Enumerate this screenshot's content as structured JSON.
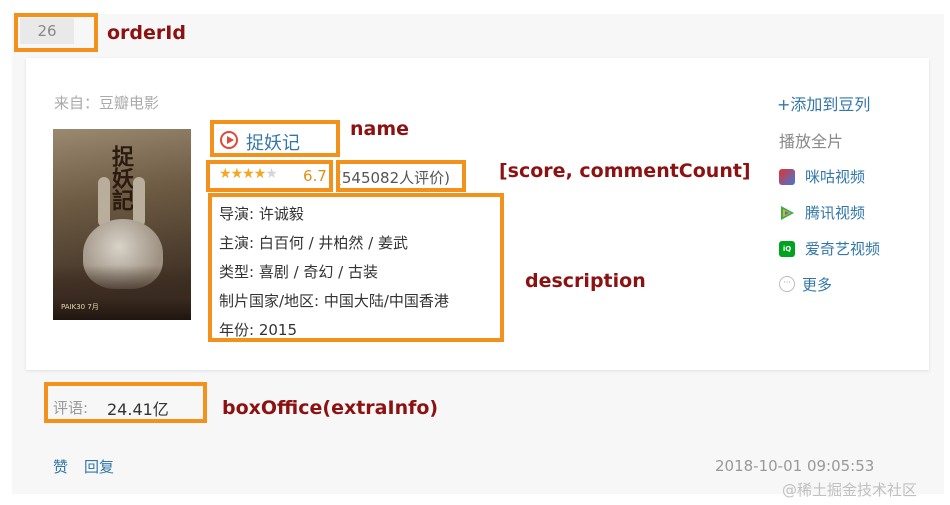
{
  "order_id": "26",
  "source_label": "来自：豆瓣电影",
  "movie": {
    "name": "捉妖记",
    "rating_stars": 3.5,
    "score": "6.7",
    "comment_count": "(545082人评价)",
    "description": [
      "导演: 许诚毅",
      "主演: 白百何 / 井柏然 / 姜武",
      "类型: 喜剧 / 奇幻 / 古装",
      "制片国家/地区: 中国大陆/中国香港",
      "年份: 2015"
    ],
    "poster": {
      "title_text": "捉妖記",
      "date_text": "PAIK30 7月"
    }
  },
  "sidebar": {
    "add_to_list": "+添加到豆列",
    "play_full": "播放全片",
    "platforms": [
      {
        "label": "咪咕视频",
        "icon": "migu-icon",
        "color": "#e6312f"
      },
      {
        "label": "腾讯视频",
        "icon": "tencent-video-icon",
        "color": "#2fb24c"
      },
      {
        "label": "爱奇艺视频",
        "icon": "iqiyi-icon",
        "color": "#00a31e"
      }
    ],
    "more_label": "更多"
  },
  "comment": {
    "label": "评语:",
    "value": "24.41亿"
  },
  "footer": {
    "like": "赞",
    "reply": "回复",
    "timestamp": "2018-10-01 09:05:53"
  },
  "annotations": {
    "order_id": "orderId",
    "name": "name",
    "score": "[score, commentCount]",
    "description": "description",
    "box_office": "boxOffice(extraInfo)"
  },
  "watermark": "@稀土掘金技术社区",
  "colors": {
    "highlight": "#f2911c",
    "annotation": "#8c1212",
    "link": "#3377aa",
    "score": "#e09015"
  }
}
